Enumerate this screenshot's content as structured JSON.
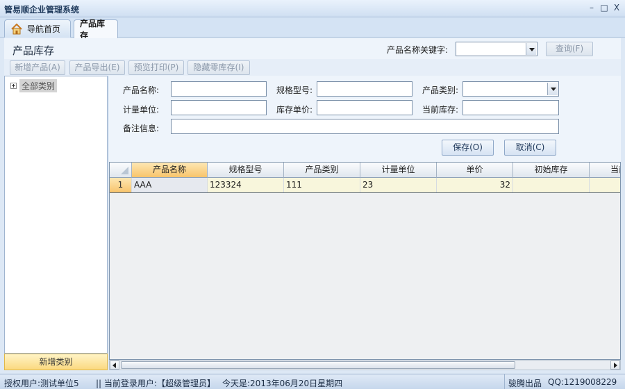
{
  "app": {
    "title": "管易顺企业管理系统"
  },
  "window_controls": {
    "minimize": "–",
    "maximize": "□",
    "close": "X"
  },
  "tabs": [
    {
      "label": "导航首页",
      "icon": "home-icon"
    },
    {
      "label": "产品库存",
      "active": true
    }
  ],
  "header": {
    "page_title": "产品库存",
    "keyword_label": "产品名称关键字:",
    "keyword_value": "",
    "query_button": "查询(F)"
  },
  "toolbar": {
    "add_product": "新增产品(A)",
    "export_product": "产品导出(E)",
    "print_preview": "预览打印(P)",
    "hide_zero_stock": "隐藏零库存(I)"
  },
  "tree": {
    "root_label": "全部类别"
  },
  "left_panel": {
    "add_category": "新增类别"
  },
  "form": {
    "product_name_label": "产品名称:",
    "spec_label": "规格型号:",
    "category_label": "产品类别:",
    "unit_label": "计量单位:",
    "stock_price_label": "库存单价:",
    "current_stock_label": "当前库存:",
    "remark_label": "备注信息:",
    "save_button": "保存(O)",
    "cancel_button": "取消(C)"
  },
  "grid": {
    "columns": [
      "产品名称",
      "规格型号",
      "产品类别",
      "计量单位",
      "单价",
      "初始库存",
      "当前"
    ],
    "rows": [
      {
        "num": "1",
        "name": "AAA",
        "spec": "123324",
        "category": "111",
        "unit": "23",
        "price": "32",
        "initial_stock": "",
        "current": ""
      }
    ]
  },
  "status": {
    "licensed_user": "授权用户:测试单位5",
    "login_user": "|| 当前登录用户:【超级管理员】",
    "today": "今天是:2013年06月20日星期四",
    "vendor": "骏腾出品",
    "qq": "QQ:1219008229"
  },
  "colors": {
    "accent": "#f8c46c",
    "background": "#dde8f5",
    "row_highlight": "#f8f6dc"
  }
}
